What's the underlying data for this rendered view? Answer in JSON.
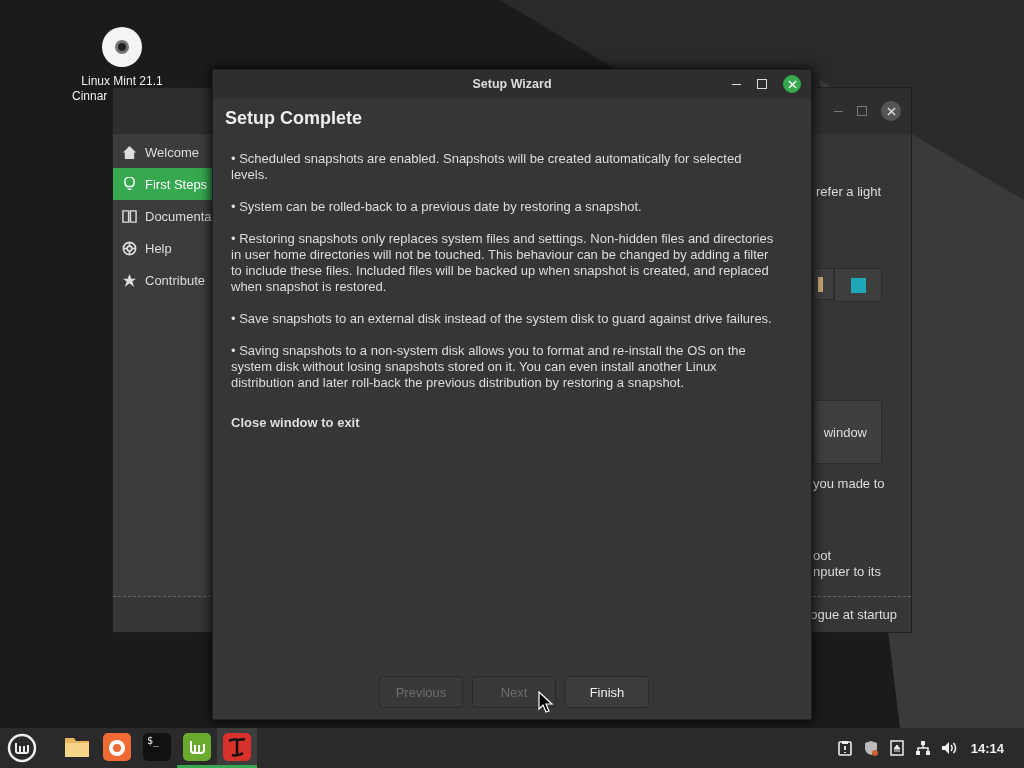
{
  "desktop_icon": {
    "label_lines": [
      "Linux Mint 21.1",
      "Cinnar"
    ]
  },
  "welcome_window": {
    "sidebar": [
      {
        "kind": "home",
        "label": "Welcome",
        "selected": false
      },
      {
        "kind": "bulb",
        "label": "First Steps",
        "selected": true
      },
      {
        "kind": "book",
        "label": "Documenta",
        "selected": false
      },
      {
        "kind": "lifebuoy",
        "label": "Help",
        "selected": false
      },
      {
        "kind": "star",
        "label": "Contribute",
        "selected": false
      }
    ],
    "theme_text": "refer a light",
    "swatches": [
      {
        "color": "#c8a870"
      },
      {
        "color": "#1fa7b8"
      }
    ],
    "panel_button": "window",
    "panel_note": "you made to",
    "boot_lines": [
      "oot",
      "nputer to its"
    ],
    "footer": "ogue at startup"
  },
  "wizard": {
    "title": "Setup Wizard",
    "heading": "Setup Complete",
    "paragraphs": [
      "• Scheduled snapshots are enabled. Snapshots will be created automatically for selected levels.",
      "• System can be rolled-back to a previous date by restoring a snapshot.",
      "• Restoring snapshots only replaces system files and settings. Non-hidden files and directories in user home directories will not be touched. This behaviour can be changed by adding a filter to include these files. Included files will be backed up when snapshot is created, and replaced when snapshot is restored.",
      "• Save snapshots to an external disk instead of the system disk to guard against drive failures.",
      "• Saving snapshots to a non-system disk allows you to format and re-install the OS on the system disk without losing snapshots stored on it. You can even install another Linux distribution and later roll-back the previous distribution by restoring a snapshot."
    ],
    "closing": "Close window to exit",
    "buttons": [
      {
        "label": "Previous",
        "disabled": true
      },
      {
        "label": "Next",
        "disabled": true
      },
      {
        "label": "Finish",
        "disabled": false
      }
    ]
  },
  "taskbar": {
    "apps": [
      {
        "kind": "folder",
        "running": false
      },
      {
        "kind": "browser",
        "running": false
      },
      {
        "kind": "terminal",
        "label": "$_",
        "running": false
      },
      {
        "kind": "mint",
        "running": true
      },
      {
        "kind": "red",
        "running": true
      }
    ],
    "clock": "14:14"
  }
}
